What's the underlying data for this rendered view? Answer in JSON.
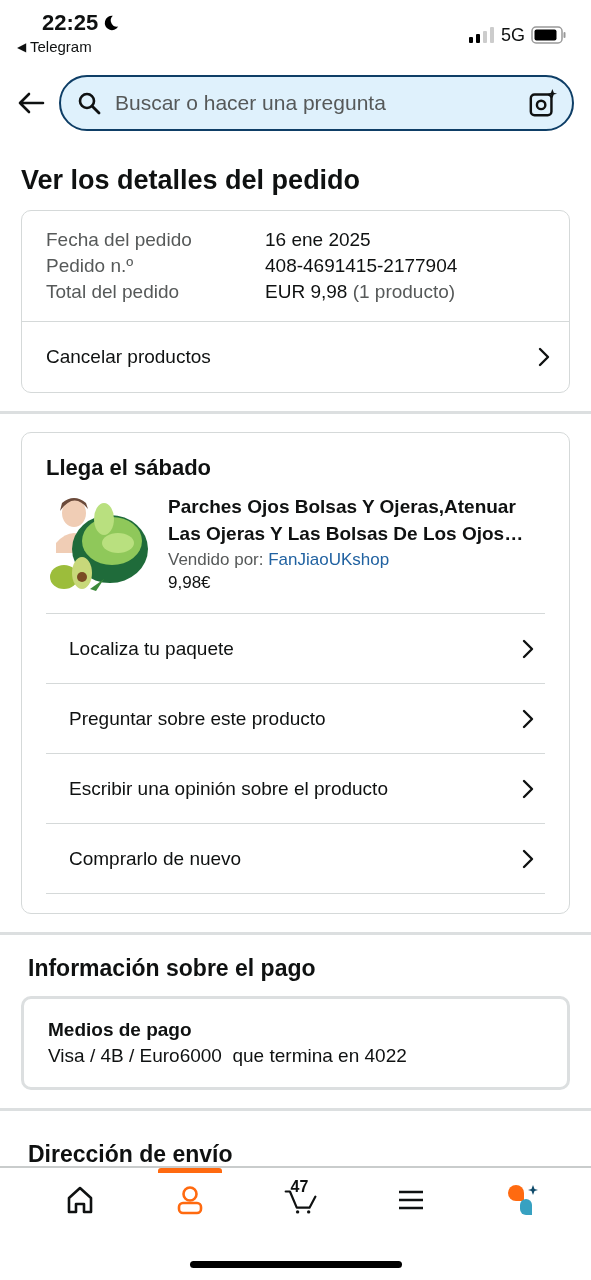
{
  "status_bar": {
    "time": "22:25",
    "back_arrow": "◀",
    "back_app": "Telegram",
    "network": "5G"
  },
  "search": {
    "placeholder": "Buscar o hacer una pregunta"
  },
  "title": "Ver los detalles del pedido",
  "order_summary": {
    "rows": [
      {
        "label": "Fecha del pedido",
        "value": "16 ene 2025"
      },
      {
        "label": "Pedido n.º",
        "value": "408-4691415-2177904"
      },
      {
        "label": "Total del pedido",
        "value": "EUR 9,98",
        "note": "(1 producto)"
      }
    ],
    "action": "Cancelar productos"
  },
  "shipment": {
    "heading": "Llega el sábado",
    "product": {
      "title": "Parches Ojos Bolsas Y Ojeras,Atenuar Las Ojeras Y Las Bolsas De Los Ojos…",
      "sold_by_label": "Vendido por:",
      "seller": "FanJiaoUKshop",
      "price": "9,98€"
    },
    "actions": [
      "Localiza tu paquete",
      "Preguntar sobre este producto",
      "Escribir una opinión sobre el producto",
      "Comprarlo de nuevo"
    ]
  },
  "payment": {
    "heading": "Información sobre el pago",
    "method_label": "Medios de pago",
    "method": "Visa / 4B / Euro6000  que termina en 4022"
  },
  "shipping_address": {
    "heading": "Dirección de envío"
  },
  "bottom_nav": [
    {
      "kind": "home",
      "selected": false
    },
    {
      "kind": "account",
      "selected": true
    },
    {
      "kind": "cart",
      "selected": false,
      "count": "47"
    },
    {
      "kind": "menu",
      "selected": false
    },
    {
      "kind": "assistant",
      "selected": false
    }
  ]
}
